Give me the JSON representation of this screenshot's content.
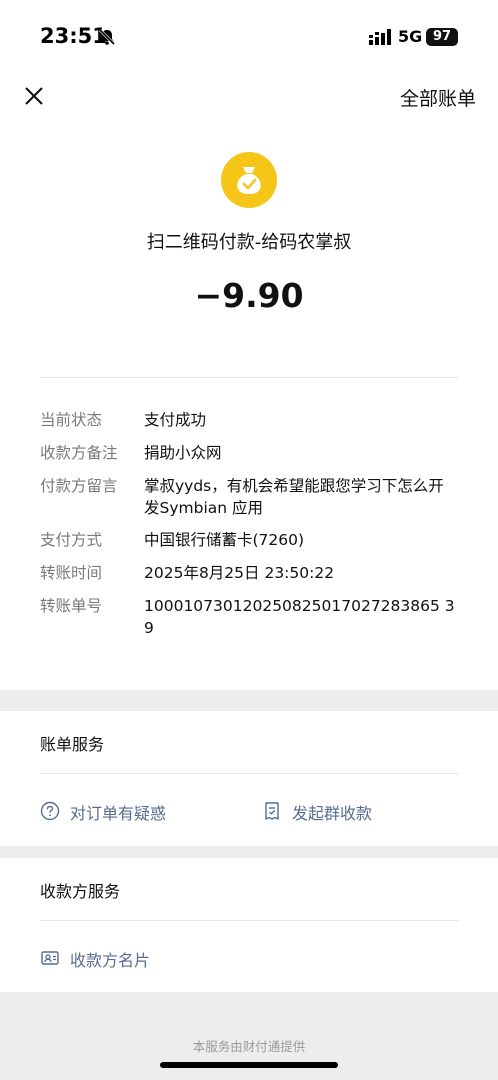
{
  "status_bar": {
    "time": "23:51",
    "network": "5G",
    "battery": "97"
  },
  "nav": {
    "close_icon": "close-icon",
    "all_bills": "全部账单"
  },
  "transaction": {
    "merchant_icon": "money-bag-check-icon",
    "title": "扫二维码付款-给码农掌叔",
    "amount": "−9.90",
    "details": [
      {
        "label": "当前状态",
        "value": "支付成功"
      },
      {
        "label": "收款方备注",
        "value": "捐助小众网"
      },
      {
        "label": "付款方留言",
        "value": "掌叔yyds，有机会希望能跟您学习下怎么开发Symbian 应用"
      },
      {
        "label": "支付方式",
        "value": "中国银行储蓄卡(7260)"
      },
      {
        "label": "转账时间",
        "value": "2025年8月25日 23:50:22"
      },
      {
        "label": "转账单号",
        "value": "100010730120250825017027283865 39"
      }
    ]
  },
  "bill_service": {
    "title": "账单服务",
    "question": "对订单有疑惑",
    "group_collect": "发起群收款"
  },
  "payee_service": {
    "title": "收款方服务",
    "payee_card": "收款方名片"
  },
  "footer": {
    "note": "本服务由财付通提供"
  },
  "colors": {
    "accent_link": "#5a6b91",
    "merchant_icon_bg": "#f5c518",
    "page_bg": "#ededed"
  }
}
